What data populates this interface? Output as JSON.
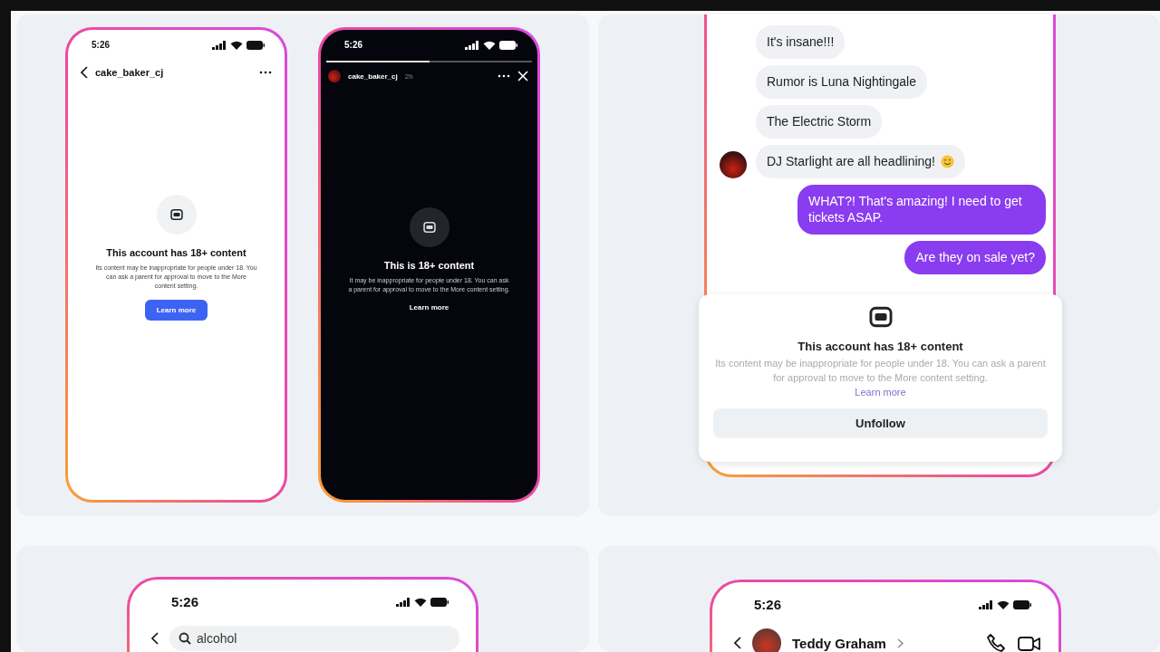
{
  "panels": [
    {
      "kind": "phones",
      "phones": [
        {
          "kind": "light",
          "time": "5:26",
          "username": "cake_baker_cj",
          "title": "This account has 18+ content",
          "body": "Its content may be inappropriate for people under 18. You can ask a parent for approval to move to the More content setting.",
          "action": "Learn more"
        },
        {
          "kind": "dark",
          "time": "5:26",
          "username": "cake_baker_cj",
          "age": "2h",
          "level": 0.5,
          "title": "This is 18+ content",
          "body": "It may be inappropriate for people under 18. You can ask a parent for approval to move to the More content setting.",
          "action": "Learn more"
        }
      ]
    },
    {
      "kind": "chat",
      "messages": [
        {
          "text": "It's insane!!!",
          "sent": false,
          "avatar": false,
          "emoji": false
        },
        {
          "text": "Rumor is Luna Nightingale",
          "sent": false,
          "avatar": false,
          "emoji": false
        },
        {
          "text": "The Electric Storm",
          "sent": false,
          "avatar": false,
          "emoji": false
        },
        {
          "text": "DJ Starlight are all headlining!",
          "sent": false,
          "avatar": true,
          "emoji": true
        },
        {
          "text": "WHAT?! That's amazing! I need to get tickets ASAP.",
          "sent": true,
          "avatar": false,
          "emoji": false
        },
        {
          "text": "Are they on sale yet?",
          "sent": true,
          "avatar": false,
          "emoji": false
        }
      ],
      "notice": {
        "title": "This account has 18+ content",
        "body": "Its content may be inappropriate for people under 18. You can ask a parent for approval to move to the More content setting.",
        "link": "Learn more",
        "button": "Unfollow"
      }
    },
    {
      "kind": "search",
      "time": "5:26",
      "query": "alcohol"
    },
    {
      "kind": "chat_header",
      "time": "5:26",
      "name": "Teddy Graham"
    }
  ]
}
